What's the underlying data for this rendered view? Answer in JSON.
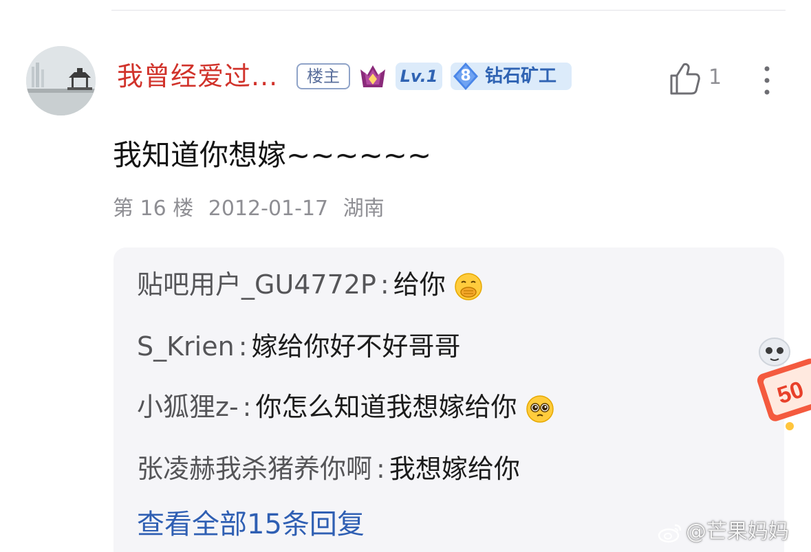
{
  "post": {
    "username": "我曾经爱过...",
    "badges": {
      "owner": "楼主",
      "level": "Lv.1",
      "rank_number": "8",
      "rank_label": "钻石矿工"
    },
    "likes": "1",
    "content": "我知道你想嫁~~~~~~",
    "meta": {
      "floor": "第 16 楼",
      "date": "2012-01-17",
      "location": "湖南"
    }
  },
  "replies": [
    {
      "name": "贴吧用户_GU4772P",
      "text": "给你",
      "emoji": "cover-mouth-emoji"
    },
    {
      "name": "S_Krien",
      "text": "嫁给你好不好哥哥",
      "emoji": ""
    },
    {
      "name": "小狐狸z-",
      "text": "你怎么知道我想嫁给你",
      "emoji": "pleading-face-emoji"
    },
    {
      "name": "张凌赫我杀猪养你啊",
      "text": "我想嫁给你",
      "emoji": ""
    }
  ],
  "replies_separator": ":",
  "view_all_label": "查看全部15条回复",
  "float_ad": {
    "text": "50"
  },
  "watermark": "@芒果妈妈",
  "colors": {
    "username": "#d1332b",
    "link": "#2f5fb3",
    "meta": "#8e8e93",
    "badge_bg": "#dcebfa"
  }
}
